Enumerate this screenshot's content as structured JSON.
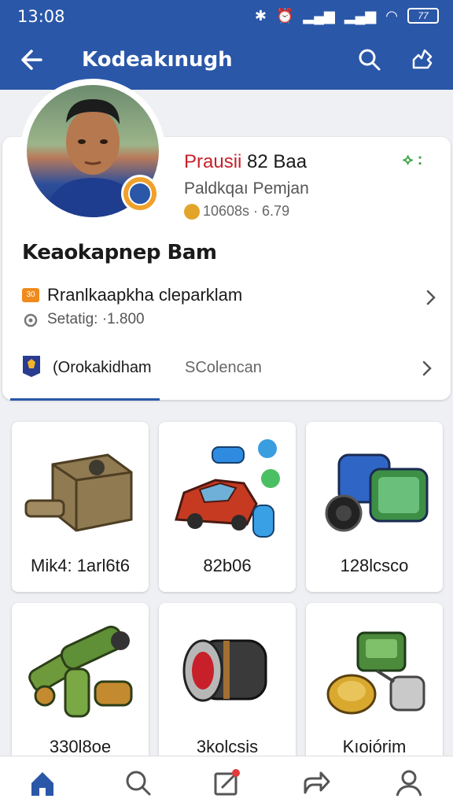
{
  "status_bar": {
    "time": "13:08",
    "battery": "77"
  },
  "app_bar": {
    "title": "Kodeakınugh",
    "back_icon": "arrow-left-icon",
    "search_icon": "search-icon",
    "share_icon": "share-icon"
  },
  "profile": {
    "name_red": "Prausii",
    "name_rest": " 82 Baa",
    "subtitle": "Paldkqaı Pemjan",
    "score": "10608s · 6.79",
    "player_name": "Keaokapnep Bam",
    "rank_tag": "30",
    "rank_label": "Rranlkaapkha cleparklam",
    "setting_label": "Setatig: ·1.800",
    "tab_active": "(Orokakidham",
    "tab_inactive": "SColencan"
  },
  "items": [
    {
      "caption": "Mik4: 1arl6t6",
      "icon": "engine-block-icon"
    },
    {
      "caption": "82b06",
      "icon": "car-parts-icon"
    },
    {
      "caption": "128lcsco",
      "icon": "camera-icon"
    },
    {
      "caption": "330l8oe",
      "icon": "rockets-icon"
    },
    {
      "caption": "3kolcsis",
      "icon": "cylinder-icon"
    },
    {
      "caption": "Kıoiórim",
      "icon": "coin-gadget-icon"
    }
  ],
  "bottom_nav": [
    "home-icon",
    "search-icon",
    "edit-icon",
    "share-icon",
    "profile-icon"
  ],
  "colors": {
    "primary": "#2a57a8",
    "accent_red": "#c8202a",
    "accent_green": "#3aa341"
  }
}
